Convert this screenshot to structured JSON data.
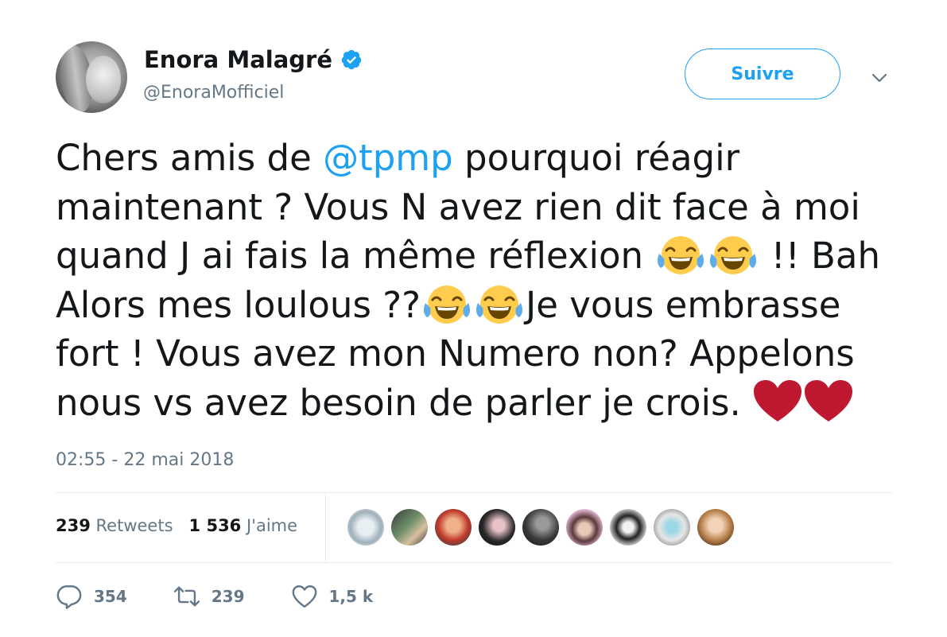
{
  "user": {
    "display_name": "Enora Malagré",
    "handle": "@EnoraMofficiel",
    "avatar_icon": "user-avatar",
    "verified_icon": "verified-badge-icon"
  },
  "follow_button": {
    "label": "Suivre"
  },
  "menu_icon": "chevron-down-icon",
  "tweet": {
    "lines": [
      [
        "Chers amis de ",
        "@tpmp",
        " pourquoi réagir"
      ],
      [
        "maintenant ? Vous N avez rien dit face à moi"
      ],
      [
        "quand J ai fais la même réflexion ",
        " !! Bah"
      ],
      [
        "Alors mes loulous ??",
        "Je vous embrasse"
      ],
      [
        "fort ! Vous avez mon Numero non? Appelons"
      ],
      [
        "nous vs avez besoin de parler je crois. "
      ]
    ],
    "emoji_names": [
      "face-with-tears-of-joy",
      "red-heart"
    ]
  },
  "timestamp": "02:55 - 22 mai 2018",
  "stats": {
    "retweets_count": "239",
    "retweets_label": "Retweets",
    "likes_count": "1 536",
    "likes_label": "J'aime"
  },
  "likers_count_shown": 9,
  "actions": {
    "reply_count": "354",
    "retweet_count": "239",
    "like_count": "1,5 k"
  },
  "colors": {
    "accent": "#1da1f2",
    "text": "#14171a",
    "muted": "#657786",
    "divider": "#e6ecf0",
    "heart": "#cc2233"
  }
}
